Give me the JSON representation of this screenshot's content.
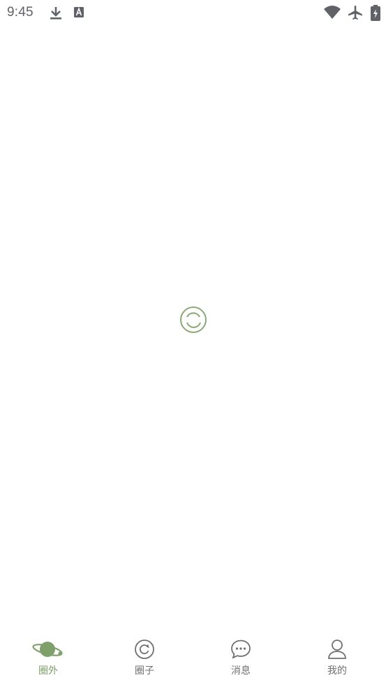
{
  "status_bar": {
    "time": "9:45",
    "left_icons": [
      "download-icon",
      "a-icon"
    ],
    "right_icons": [
      "wifi-icon",
      "airplane-icon",
      "battery-charging-icon"
    ]
  },
  "loader": {
    "icon": "loading-spinner-icon",
    "color": "#8aa876"
  },
  "tabs": [
    {
      "label": "圈外",
      "icon": "planet-icon",
      "active": true
    },
    {
      "label": "圈子",
      "icon": "refresh-circle-icon",
      "active": false
    },
    {
      "label": "消息",
      "icon": "chat-bubble-icon",
      "active": false
    },
    {
      "label": "我的",
      "icon": "person-icon",
      "active": false
    }
  ],
  "colors": {
    "accent": "#7ea06a",
    "inactive": "#707070"
  }
}
